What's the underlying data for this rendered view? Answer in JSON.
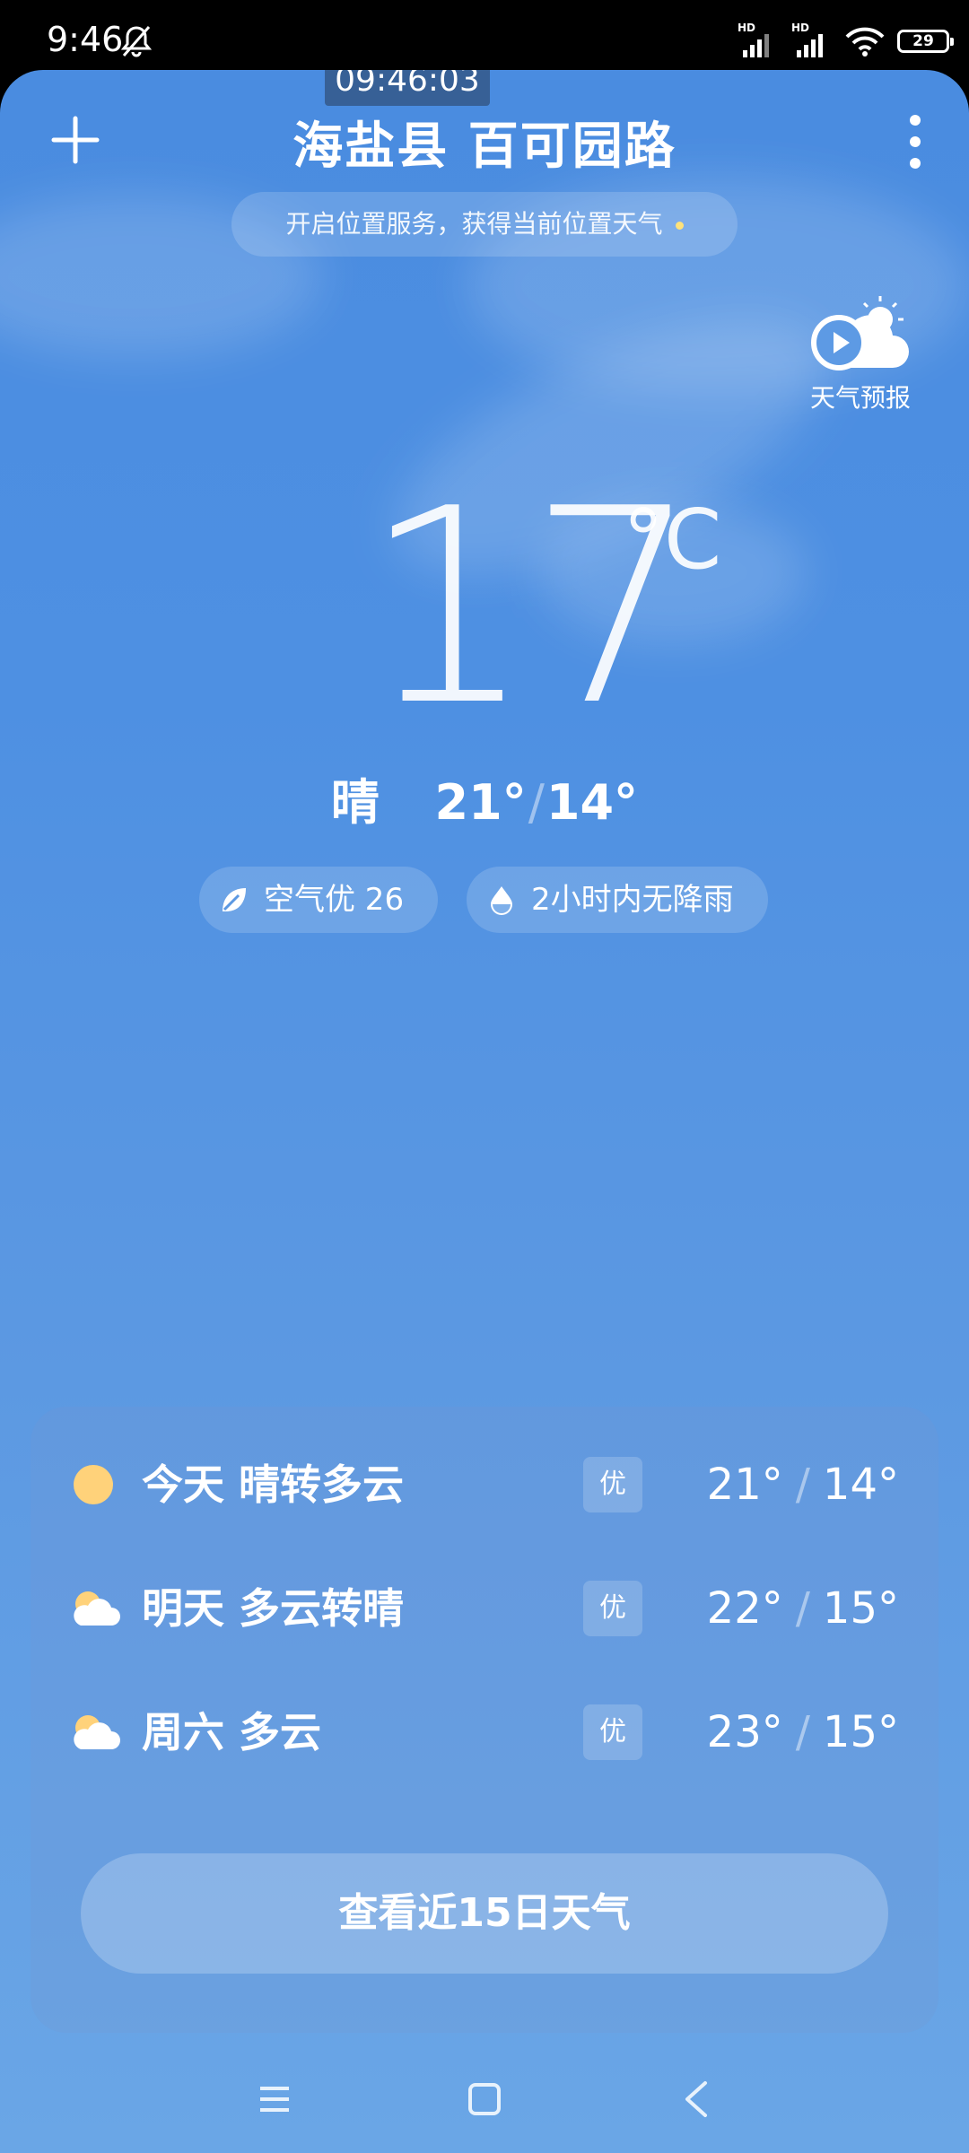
{
  "status_bar": {
    "time": "9:46",
    "battery": "29",
    "signal_label": "HD"
  },
  "overlay_clock": "09:46:03",
  "header": {
    "location": "海盐县 百可园路"
  },
  "location_banner": "开启位置服务，获得当前位置天气",
  "forecast_video_label": "天气预报",
  "current": {
    "temperature": "17",
    "unit": "°C",
    "condition": "晴",
    "high": "21°",
    "low": "14°"
  },
  "chips": {
    "air_quality": "空气优 26",
    "rain": "2小时内无降雨"
  },
  "forecast": [
    {
      "label": "今天  晴转多云",
      "aqi": "优",
      "high": "21°",
      "low": "14°",
      "icon": "sun-icon"
    },
    {
      "label": "明天  多云转晴",
      "aqi": "优",
      "high": "22°",
      "low": "15°",
      "icon": "partly-cloudy-icon"
    },
    {
      "label": "周六  多云",
      "aqi": "优",
      "high": "23°",
      "low": "15°",
      "icon": "partly-cloudy-icon"
    }
  ],
  "view_15_days": "查看近15日天气",
  "colors": {
    "sky_top": "#4a8ce0",
    "sky_bottom": "#6aa6e6",
    "sun": "#ffd27a",
    "banner_dot": "#ffe27a"
  }
}
